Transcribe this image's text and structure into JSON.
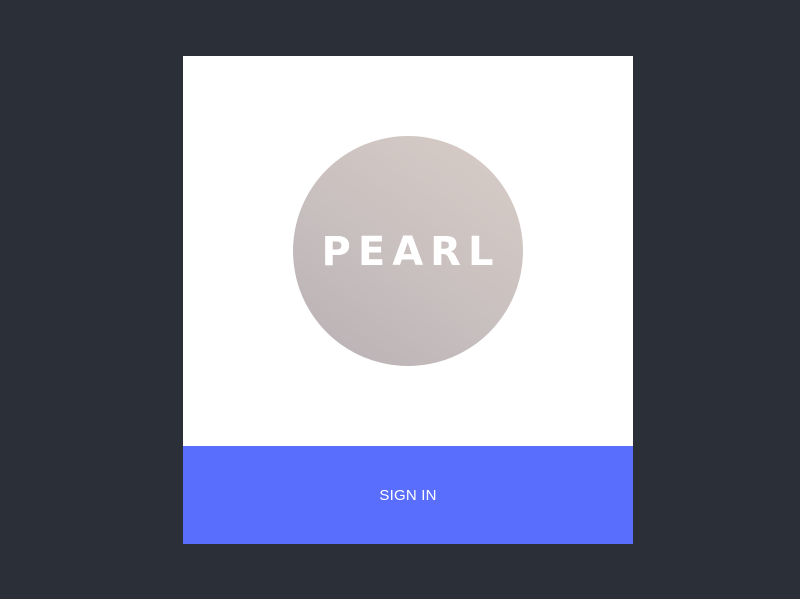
{
  "logo": {
    "text": "PEARL",
    "colors": {
      "circle_gradient_start": "#b9b0b4",
      "circle_gradient_end": "#d8cdc6",
      "text": "#ffffff"
    }
  },
  "signin": {
    "label": "SIGN IN",
    "color": "#5a6efd"
  },
  "theme": {
    "background": "#2b2f38",
    "card": "#ffffff"
  }
}
